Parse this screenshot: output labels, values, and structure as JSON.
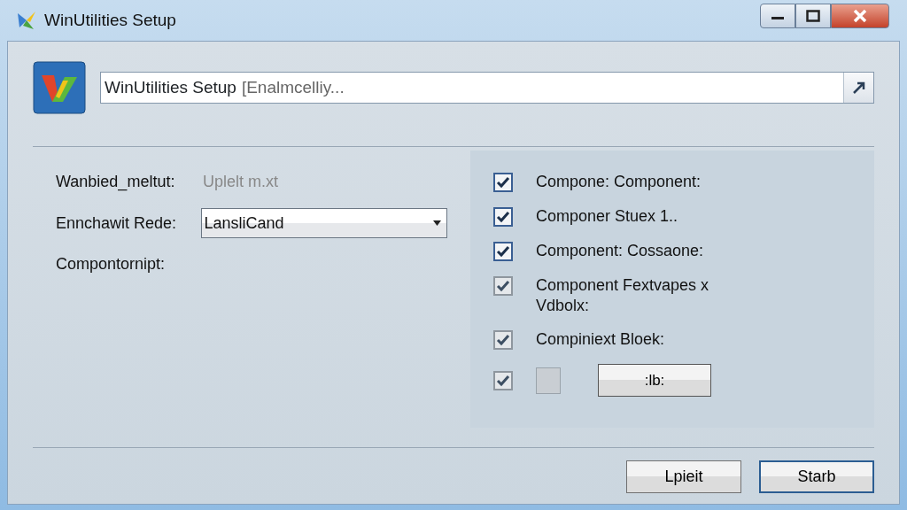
{
  "window": {
    "title": "WinUtilities Setup"
  },
  "path_field": {
    "value": "WinUtilities Setup",
    "placeholder": "[Enalmcelliy..."
  },
  "settings": [
    {
      "kind": "text",
      "label": "Wanbied_meltut:",
      "value": "Uplelt m.xt"
    },
    {
      "kind": "combo",
      "label": "Ennchawit Rede:",
      "value": "LansliCand"
    },
    {
      "kind": "label",
      "label": "Compontornipt:"
    }
  ],
  "components": [
    {
      "kind": "check",
      "label": "Compone: Component:",
      "checked": true,
      "disabled": false
    },
    {
      "kind": "check",
      "label": "Componer Stuex 1..",
      "checked": true,
      "disabled": false
    },
    {
      "kind": "check",
      "label": "Component: Cossaone:",
      "checked": true,
      "disabled": false
    },
    {
      "kind": "check",
      "label": "Component Fextvapes x Vdbolx:",
      "checked": true,
      "disabled": true
    },
    {
      "kind": "check",
      "label": "Compiniext Bloek:",
      "checked": true,
      "disabled": true
    },
    {
      "kind": "button",
      "label": ":lb:",
      "checked": true,
      "disabled": true
    }
  ],
  "buttons": [
    {
      "label": "Lpieit",
      "default": false
    },
    {
      "label": "Starb",
      "default": true
    }
  ]
}
